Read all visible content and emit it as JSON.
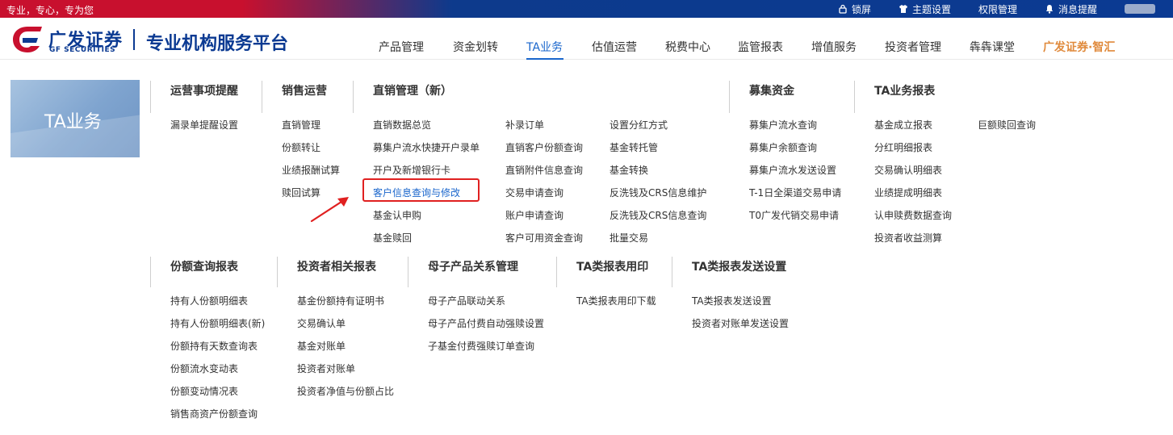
{
  "topbar": {
    "slogan": "专业，专心，专为您",
    "links": [
      {
        "label": "锁屏",
        "icon": "lock-icon"
      },
      {
        "label": "主题设置",
        "icon": "shirt-icon"
      },
      {
        "label": "权限管理",
        "icon": ""
      },
      {
        "label": "消息提醒",
        "icon": "bell-icon"
      }
    ]
  },
  "header": {
    "brand_cn": "广发证券",
    "brand_en": "GF SECURITIES",
    "platform": "专业机构服务平台"
  },
  "nav": {
    "items": [
      "产品管理",
      "资金划转",
      "TA业务",
      "估值运营",
      "税费中心",
      "监管报表",
      "增值服务",
      "投资者管理",
      "犇犇课堂",
      "广发证券·智汇"
    ],
    "active": "TA业务"
  },
  "banner": {
    "title": "TA业务"
  },
  "menu": {
    "row1": {
      "sections": [
        {
          "title": "运营事项提醒",
          "items": [
            "漏录单提醒设置"
          ]
        },
        {
          "title": "销售运营",
          "items": [
            "直销管理",
            "份额转让",
            "业绩报酬试算",
            "赎回试算"
          ]
        },
        {
          "title": "直销管理（新）",
          "col1": [
            "直销数据总览",
            "募集户流水快捷开户录单",
            "开户及新增银行卡",
            "客户信息查询与修改",
            "基金认申购",
            "基金赎回"
          ],
          "col2": [
            "补录订单",
            "直销客户份额查询",
            "直销附件信息查询",
            "交易申请查询",
            "账户申请查询",
            "客户可用资金查询"
          ],
          "col3": [
            "设置分红方式",
            "基金转托管",
            "基金转换",
            "反洗钱及CRS信息维护",
            "反洗钱及CRS信息查询",
            "批量交易"
          ]
        },
        {
          "title": "募集资金",
          "items": [
            "募集户流水查询",
            "募集户余额查询",
            "募集户流水发送设置",
            "T-1日全渠道交易申请",
            "T0广发代销交易申请"
          ]
        },
        {
          "title": "TA业务报表",
          "col1": [
            "基金成立报表",
            "分红明细报表",
            "交易确认明细表",
            "业绩提成明细表",
            "认申赎费数据查询",
            "投资者收益测算"
          ],
          "col2": [
            "巨额赎回查询"
          ]
        }
      ]
    },
    "row2": {
      "sections": [
        {
          "title": "份额查询报表",
          "items": [
            "持有人份额明细表",
            "持有人份额明细表(新)",
            "份额持有天数查询表",
            "份额流水变动表",
            "份额变动情况表",
            "销售商资产份额查询"
          ]
        },
        {
          "title": "投资者相关报表",
          "items": [
            "基金份额持有证明书",
            "交易确认单",
            "基金对账单",
            "投资者对账单",
            "投资者净值与份额占比"
          ]
        },
        {
          "title": "母子产品关系管理",
          "items": [
            "母子产品联动关系",
            "母子产品付费自动强赎设置",
            "子基金付费强赎订单查询"
          ]
        },
        {
          "title": "TA类报表用印",
          "items": [
            "TA类报表用印下载"
          ]
        },
        {
          "title": "TA类报表发送设置",
          "items": [
            "TA类报表发送设置",
            "投资者对账单发送设置"
          ]
        }
      ]
    },
    "highlighted": "客户信息查询与修改"
  },
  "colors": {
    "brand_red": "#c8102e",
    "brand_blue": "#0b3a92",
    "accent": "#1a66cc",
    "highlight_red": "#e02020"
  }
}
